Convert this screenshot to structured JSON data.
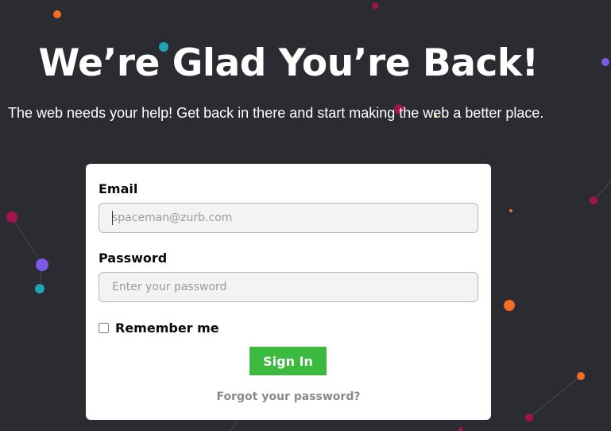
{
  "page": {
    "title": "We’re Glad You’re Back!",
    "subtitle": "The web needs your help! Get back in there and start making the web a better place."
  },
  "login_form": {
    "email_label": "Email",
    "email_placeholder": "spaceman@zurb.com",
    "email_value": "",
    "password_label": "Password",
    "password_placeholder": "Enter your password",
    "password_value": "",
    "remember_label": "Remember me",
    "remember_checked": false,
    "signin_label": "Sign In",
    "forgot_label": "Forgot your password?"
  },
  "colors": {
    "background": "#2b2c31",
    "card": "#ffffff",
    "signin_button": "#3cb93f",
    "dot_magenta": "#a3134f",
    "dot_orange": "#f26f21",
    "dot_teal": "#1fa2b5",
    "dot_purple": "#7a5ae6"
  }
}
